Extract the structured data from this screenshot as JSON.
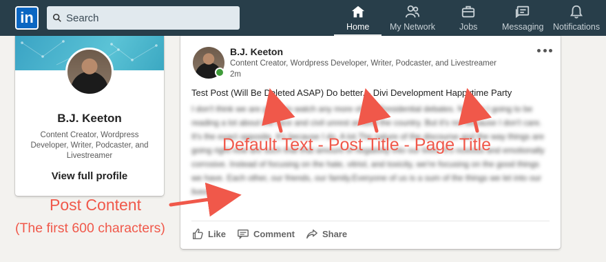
{
  "nav": {
    "logo_text": "in",
    "search_placeholder": "Search",
    "items": [
      {
        "label": "Home",
        "icon": "home-icon"
      },
      {
        "label": "My Network",
        "icon": "network-icon"
      },
      {
        "label": "Jobs",
        "icon": "jobs-icon"
      },
      {
        "label": "Messaging",
        "icon": "messaging-icon"
      },
      {
        "label": "Notifications",
        "icon": "bell-icon"
      }
    ]
  },
  "profile": {
    "name": "B.J. Keeton",
    "headline": "Content Creator, Wordpress Developer, Writer, Podcaster, and Livestreamer",
    "view_label": "View full profile"
  },
  "post": {
    "author": "B.J. Keeton",
    "headline": "Content Creator, Wordpress Developer, Writer, Podcaster, and Livestreamer",
    "time": "2m",
    "title": "Test Post (Will Be Deleted ASAP) Do better. - Divi Development Happytime Party",
    "body": "I don't think we are going to watch any more of the Presidential debates. Nor am I going to be reading a lot about the race and civil unrest around the country. But it's not because I don't care. It's the exact opposite. It's because I do. A lot.The nature of the discourse and the way things are going right now are such that that amount of negativity into our lives. It's noxious and emotionally corrosive. Instead of focusing on the hate, vitriol, and toxicity, we're focusing on the good things we have. Each other, our friends, our family.Everyone of us is a sum of the things we let into our lives.",
    "actions": {
      "like": "Like",
      "comment": "Comment",
      "share": "Share"
    }
  },
  "annotations": {
    "title_label": "Default Text - Post Title - Page Title",
    "content_label": "Post Content",
    "content_sub": "(The first 600 characters)"
  },
  "colors": {
    "nav_bg": "#283e4a",
    "brand": "#0a66c2",
    "annotation": "#f0584a",
    "online": "#3f9b3a"
  }
}
